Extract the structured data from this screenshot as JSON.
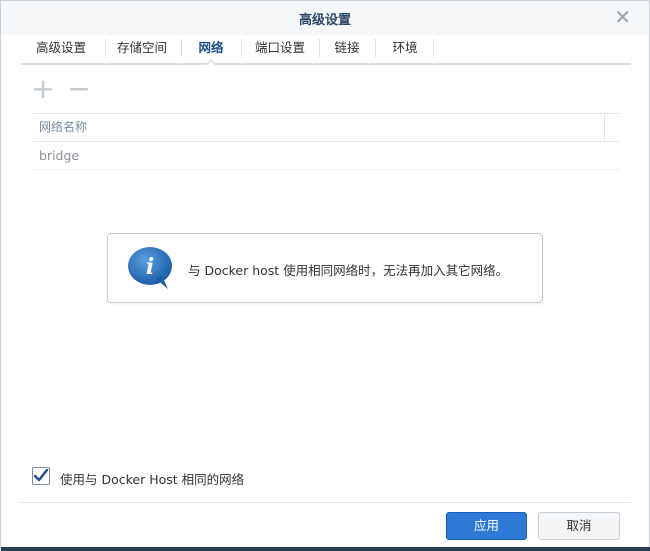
{
  "dialog": {
    "title": "高级设置"
  },
  "tabs": [
    {
      "label": "高级设置",
      "active": false
    },
    {
      "label": "存储空间",
      "active": false
    },
    {
      "label": "网络",
      "active": true
    },
    {
      "label": "端口设置",
      "active": false
    },
    {
      "label": "链接",
      "active": false
    },
    {
      "label": "环境",
      "active": false
    }
  ],
  "toolbar": {
    "add_icon": "plus-icon",
    "remove_icon": "minus-icon"
  },
  "table": {
    "header": "网络名称",
    "rows": [
      "bridge"
    ]
  },
  "info": {
    "icon": "info-icon",
    "message": "与 Docker host 使用相同网络时，无法再加入其它网络。"
  },
  "option": {
    "label": "使用与 Docker Host 相同的网络",
    "checked": true
  },
  "buttons": {
    "apply": "应用",
    "cancel": "取消"
  },
  "colors": {
    "accent": "#2f79d6",
    "active_tab": "#1f4f8a",
    "info_blue": "#2f6fb3"
  }
}
